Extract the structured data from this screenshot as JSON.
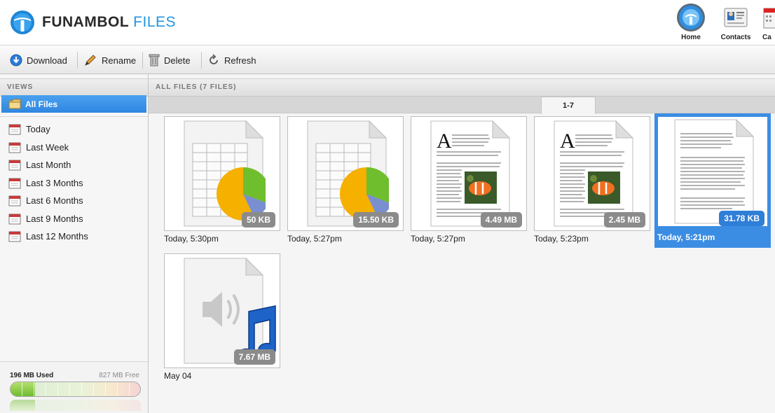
{
  "header": {
    "brand_primary": "FUNAMBOL",
    "brand_secondary": "FILES",
    "apps": [
      {
        "label": "Home",
        "icon": "home-icon"
      },
      {
        "label": "Contacts",
        "icon": "contacts-icon"
      },
      {
        "label": "Ca",
        "icon": "calendar-icon"
      }
    ]
  },
  "toolbar": {
    "download_label": "Download",
    "rename_label": "Rename",
    "delete_label": "Delete",
    "refresh_label": "Refresh"
  },
  "sidebar": {
    "title": "VIEWS",
    "selected_label": "All Files",
    "items": [
      {
        "label": "Today"
      },
      {
        "label": "Last Week"
      },
      {
        "label": "Last Month"
      },
      {
        "label": "Last 3 Months"
      },
      {
        "label": "Last 6 Months"
      },
      {
        "label": "Last 9 Months"
      },
      {
        "label": "Last 12 Months"
      }
    ],
    "storage": {
      "used_label": "196 MB Used",
      "free_label": "827 MB Free",
      "used_fraction": 0.19
    }
  },
  "main": {
    "title": "ALL FILES (7 FILES)",
    "page_tab": "1-7",
    "files": [
      {
        "size": "50 KB",
        "date": "Today, 5:30pm",
        "kind": "spreadsheet",
        "selected": false
      },
      {
        "size": "15.50 KB",
        "date": "Today, 5:27pm",
        "kind": "spreadsheet",
        "selected": false
      },
      {
        "size": "4.49 MB",
        "date": "Today, 5:27pm",
        "kind": "document-image",
        "selected": false
      },
      {
        "size": "2.45 MB",
        "date": "Today, 5:23pm",
        "kind": "document-image",
        "selected": false
      },
      {
        "size": "31.78 KB",
        "date": "Today, 5:21pm",
        "kind": "text-document",
        "selected": true
      },
      {
        "size": "7.67 MB",
        "date": "May 04",
        "kind": "audio",
        "selected": false
      }
    ]
  },
  "colors": {
    "accent": "#3b8de3",
    "brand_blue": "#2196e0",
    "size_badge": "#8b8b8b"
  }
}
